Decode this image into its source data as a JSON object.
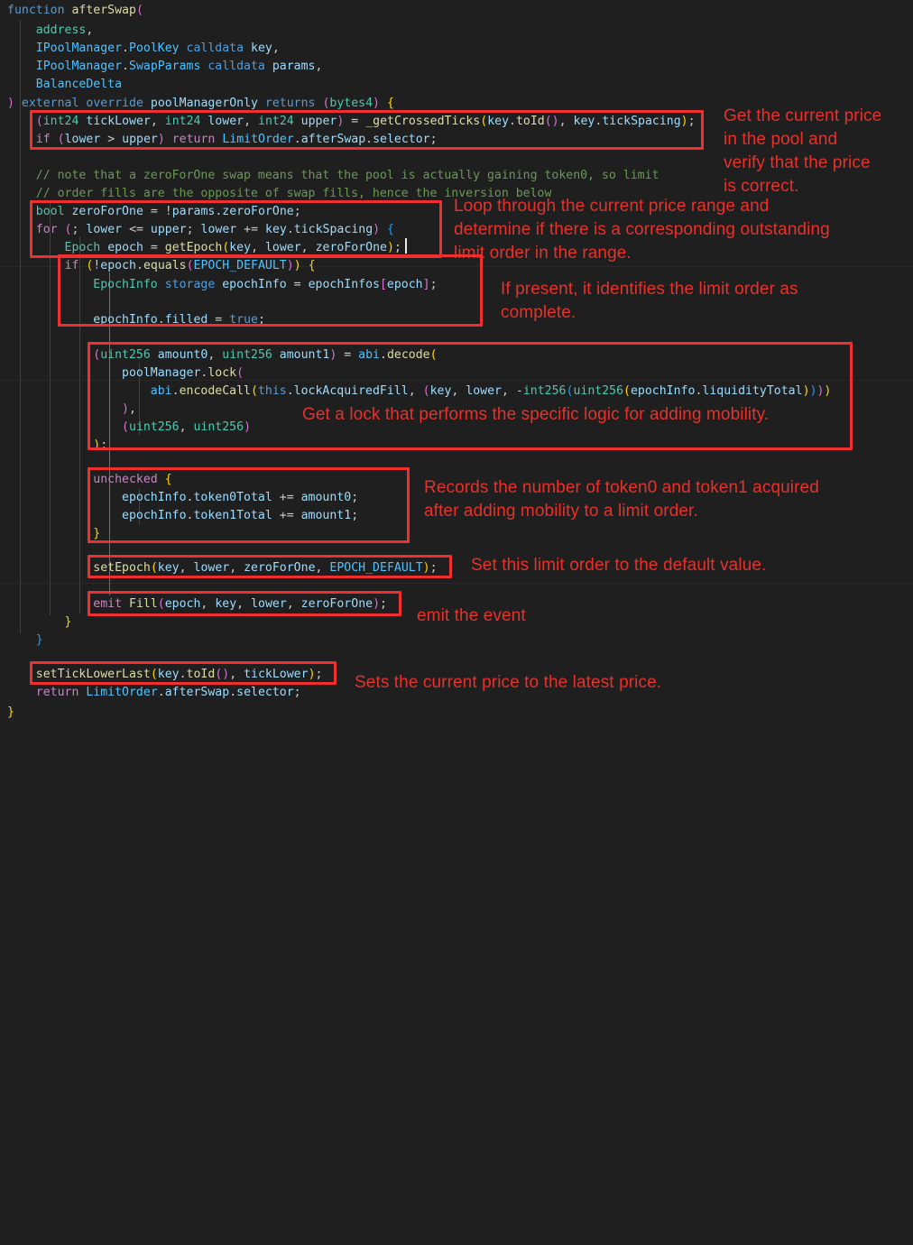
{
  "editor": {
    "background": "#1f1f1f",
    "accent_red": "#e8312a",
    "language": "solidity",
    "font_size_px": 13,
    "line_height_px": 20
  },
  "code": {
    "lines": [
      {
        "n": 1,
        "indent": 0,
        "text": "function afterSwap("
      },
      {
        "n": 2,
        "indent": 1,
        "text": "address,"
      },
      {
        "n": 3,
        "indent": 1,
        "text": "IPoolManager.PoolKey calldata key,"
      },
      {
        "n": 4,
        "indent": 1,
        "text": "IPoolManager.SwapParams calldata params,"
      },
      {
        "n": 5,
        "indent": 1,
        "text": "BalanceDelta"
      },
      {
        "n": 6,
        "indent": 0,
        "text": ") external override poolManagerOnly returns (bytes4) {"
      },
      {
        "n": 7,
        "indent": 1,
        "text": "(int24 tickLower, int24 lower, int24 upper) = _getCrossedTicks(key.toId(), key.tickSpacing);"
      },
      {
        "n": 8,
        "indent": 1,
        "text": "if (lower > upper) return LimitOrder.afterSwap.selector;"
      },
      {
        "n": 9,
        "indent": 0,
        "text": ""
      },
      {
        "n": 10,
        "indent": 1,
        "text": "// note that a zeroForOne swap means that the pool is actually gaining token0, so limit"
      },
      {
        "n": 11,
        "indent": 1,
        "text": "// order fills are the opposite of swap fills, hence the inversion below"
      },
      {
        "n": 12,
        "indent": 1,
        "text": "bool zeroForOne = !params.zeroForOne;"
      },
      {
        "n": 13,
        "indent": 1,
        "text": "for (; lower <= upper; lower += key.tickSpacing) {"
      },
      {
        "n": 14,
        "indent": 2,
        "text": "Epoch epoch = getEpoch(key, lower, zeroForOne);"
      },
      {
        "n": 15,
        "indent": 2,
        "text": "if (!epoch.equals(EPOCH_DEFAULT)) {"
      },
      {
        "n": 16,
        "indent": 3,
        "text": "EpochInfo storage epochInfo = epochInfos[epoch];"
      },
      {
        "n": 17,
        "indent": 0,
        "text": ""
      },
      {
        "n": 18,
        "indent": 3,
        "text": "epochInfo.filled = true;"
      },
      {
        "n": 19,
        "indent": 0,
        "text": ""
      },
      {
        "n": 20,
        "indent": 3,
        "text": "(uint256 amount0, uint256 amount1) = abi.decode("
      },
      {
        "n": 21,
        "indent": 4,
        "text": "poolManager.lock("
      },
      {
        "n": 22,
        "indent": 5,
        "text": "abi.encodeCall(this.lockAcquiredFill, (key, lower, -int256(uint256(epochInfo.liquidityTotal))))"
      },
      {
        "n": 23,
        "indent": 4,
        "text": "),"
      },
      {
        "n": 24,
        "indent": 4,
        "text": "(uint256, uint256)"
      },
      {
        "n": 25,
        "indent": 3,
        "text": ");"
      },
      {
        "n": 26,
        "indent": 0,
        "text": ""
      },
      {
        "n": 27,
        "indent": 3,
        "text": "unchecked {"
      },
      {
        "n": 28,
        "indent": 4,
        "text": "epochInfo.token0Total += amount0;"
      },
      {
        "n": 29,
        "indent": 4,
        "text": "epochInfo.token1Total += amount1;"
      },
      {
        "n": 30,
        "indent": 3,
        "text": "}"
      },
      {
        "n": 31,
        "indent": 0,
        "text": ""
      },
      {
        "n": 32,
        "indent": 3,
        "text": "setEpoch(key, lower, zeroForOne, EPOCH_DEFAULT);"
      },
      {
        "n": 33,
        "indent": 0,
        "text": ""
      },
      {
        "n": 34,
        "indent": 3,
        "text": "emit Fill(epoch, key, lower, zeroForOne);"
      },
      {
        "n": 35,
        "indent": 2,
        "text": "}"
      },
      {
        "n": 36,
        "indent": 1,
        "text": "}"
      },
      {
        "n": 37,
        "indent": 0,
        "text": ""
      },
      {
        "n": 38,
        "indent": 1,
        "text": "setTickLowerLast(key.toId(), tickLower);"
      },
      {
        "n": 39,
        "indent": 1,
        "text": "return LimitOrder.afterSwap.selector;"
      },
      {
        "n": 40,
        "indent": 0,
        "text": "}"
      }
    ]
  },
  "annotations": [
    {
      "id": "note-current-price",
      "text": "Get the current price\nin the pool and\nverify that the price\nis correct.",
      "color": "#e8312a",
      "targets_lines": [
        7,
        8
      ]
    },
    {
      "id": "note-loop-range",
      "text": "Loop through the current price range and\ndetermine if there is a corresponding outstanding\nlimit order in the range.",
      "color": "#e8312a",
      "targets_lines": [
        12,
        13,
        14
      ]
    },
    {
      "id": "note-identify-order",
      "text": "If present, it identifies the limit order as\ncomplete.",
      "color": "#e8312a",
      "targets_lines": [
        15,
        16,
        17,
        18
      ]
    },
    {
      "id": "note-lock-logic",
      "text": "Get a lock that performs the specific logic for adding mobility.",
      "color": "#e8312a",
      "targets_lines": [
        20,
        21,
        22,
        23,
        24,
        25
      ]
    },
    {
      "id": "note-record-tokens",
      "text": "Records the number of token0 and token1 acquired\nafter adding mobility to a limit order.",
      "color": "#e8312a",
      "targets_lines": [
        27,
        28,
        29,
        30
      ]
    },
    {
      "id": "note-default-value",
      "text": "Set this limit order to the default value.",
      "color": "#e8312a",
      "targets_lines": [
        32
      ]
    },
    {
      "id": "note-emit-event",
      "text": "emit the event",
      "color": "#e8312a",
      "targets_lines": [
        34
      ]
    },
    {
      "id": "note-latest-price",
      "text": "Sets the current price to the latest price.",
      "color": "#e8312a",
      "targets_lines": [
        38
      ]
    }
  ],
  "highlight_boxes": [
    {
      "id": "box-crossed-ticks",
      "label": "highlight-getCrossedTicks"
    },
    {
      "id": "box-loop",
      "label": "highlight-for-loop"
    },
    {
      "id": "box-epoch-check",
      "label": "highlight-epoch-equals"
    },
    {
      "id": "box-abi-decode",
      "label": "highlight-abi-decode"
    },
    {
      "id": "box-unchecked",
      "label": "highlight-unchecked-block"
    },
    {
      "id": "box-set-epoch",
      "label": "highlight-setEpoch"
    },
    {
      "id": "box-emit-fill",
      "label": "highlight-emit-fill"
    },
    {
      "id": "box-set-tick",
      "label": "highlight-setTickLowerLast"
    }
  ]
}
